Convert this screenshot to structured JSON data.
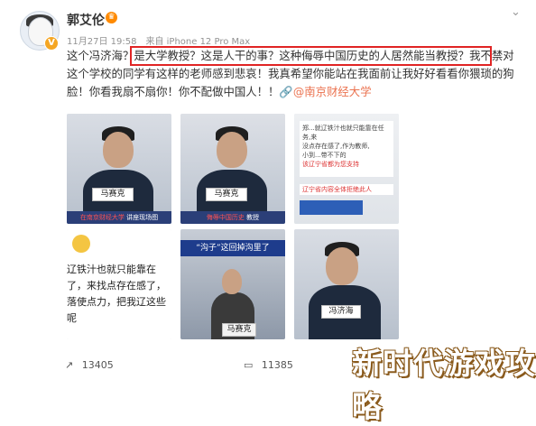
{
  "header": {
    "username": "郭艾伦",
    "user_badge_icon": "crown-icon",
    "verified_badge": "V",
    "timestamp": "11月27日 19:58",
    "source": "来自 iPhone 12 Pro Max"
  },
  "post": {
    "text_before_box": "这个冯济海？",
    "text_in_box": "是大学教授？这是人干的事？这种侮辱中国历史的人居然能当教授？",
    "text_after_box": "我不禁对这个学校的同学有这样的老师感到悲哀！我真希望你能站在我面前让我好好看看你猥琐的狗脸！你看我扇不扇你！你不配做中国人！！",
    "mention": "@南京财经大学",
    "mention_icon": "link-icon"
  },
  "images": [
    {
      "namecard": "马赛克",
      "caption_left": "在南京财经大学",
      "caption_right": "讲座现场图"
    },
    {
      "namecard": "马赛克",
      "caption_left": "侮辱中国历史",
      "caption_right": "教授"
    },
    {
      "chat_lines": [
        "郑...就辽铁汁也就只能靠在任务,来",
        "没点存在感了,作为教师,",
        "小到...带不下的",
        "该辽宁省都为您支持"
      ],
      "caption": "辽宁省内容全体拒绝此人"
    },
    {
      "lines": [
        "辽铁汁也就只能靠在",
        "了，来找点存在感了，",
        "落使点力，把我辽这些",
        "呢"
      ]
    },
    {
      "banner": "“沟子”这回掉沟里了",
      "namecard": "马赛克"
    },
    {
      "namecard": "冯济海"
    }
  ],
  "footer": {
    "repost_icon": "share-icon",
    "repost_count": "13405",
    "comment_icon": "comment-icon",
    "comment_count": "11385"
  },
  "watermark": "新时代游戏攻略"
}
